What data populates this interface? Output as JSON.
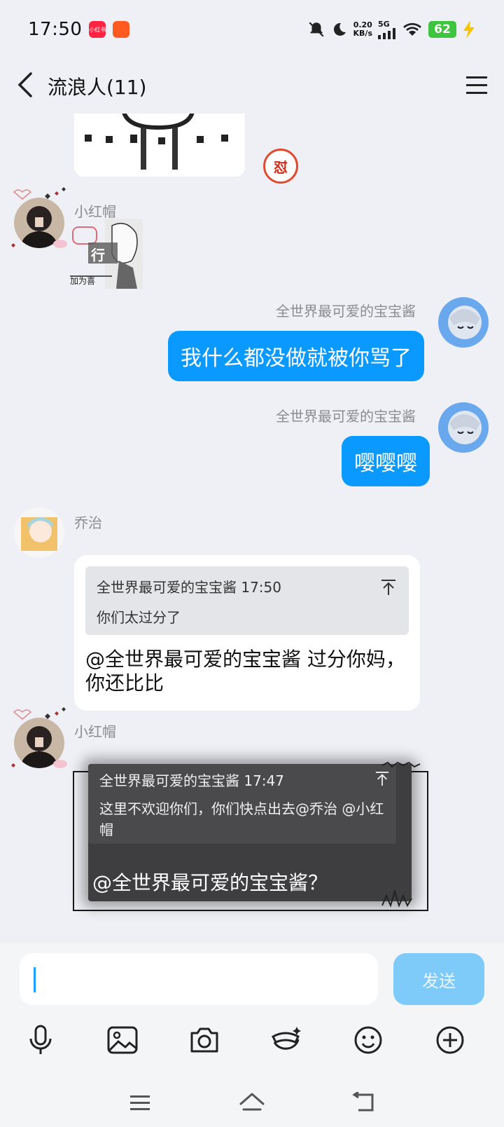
{
  "status_bar": {
    "time": "17:50",
    "app_badges": [
      "小红书",
      ""
    ],
    "net_speed": "0.20",
    "net_unit": "KB/s",
    "signal": "5G",
    "battery": "62"
  },
  "header": {
    "title": "流浪人(11)"
  },
  "messages": [
    {
      "sender": "小红帽",
      "sticker_text_1": "行",
      "sticker_text_2": "加为喜"
    },
    {
      "sender": "全世界最可爱的宝宝酱",
      "text": "我什么都没做就被你骂了"
    },
    {
      "sender": "全世界最可爱的宝宝酱",
      "text": "嘤嘤嘤"
    },
    {
      "sender": "乔治",
      "quote_header": "全世界最可爱的宝宝酱 17:50",
      "quote_text": "你们太过分了",
      "text": "@全世界最可爱的宝宝酱 过分你妈，你还比比"
    },
    {
      "sender": "小红帽",
      "quote_header": "全世界最可爱的宝宝酱 17:47",
      "quote_text": "这里不欢迎你们，你们快点出去@乔治 @小红帽",
      "text": "@全世界最可爱的宝宝酱？"
    }
  ],
  "reaction_badge": "怼",
  "input": {
    "value": "",
    "send_label": "发送"
  },
  "toolbar_icons": [
    "microphone-icon",
    "image-icon",
    "camera-icon",
    "sticker-icon",
    "emoji-icon",
    "plus-icon"
  ],
  "colors": {
    "my_bubble": "#0a99ff",
    "send_disabled": "#7ecbfa",
    "background": "#eef0f5"
  }
}
